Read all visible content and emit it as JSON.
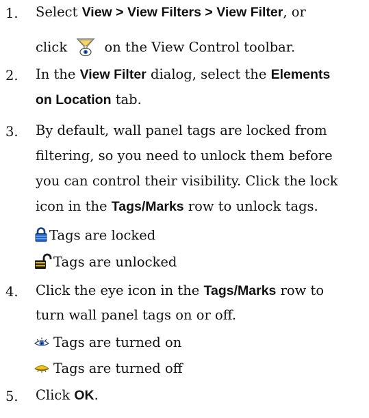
{
  "steps": [
    {
      "number": "1.",
      "line1_a": "Select ",
      "line1_b": "View > View Filters > View Filter",
      "line1_c": ", or",
      "line2_a": "click",
      "line2_icon": "view-filter-funnel-icon",
      "line2_b": "on the View Control toolbar."
    },
    {
      "number": "2.",
      "line1_a": "In the ",
      "line1_b": "View Filter",
      "line1_c": " dialog, select the ",
      "line1_d": "Elements",
      "line2_a": "on Location",
      "line2_b": " tab."
    },
    {
      "number": "3.",
      "line1": "By default, wall panel tags are locked from",
      "line2": "filtering, so you need to unlock them before",
      "line3": "you can control their visibility. Click the lock",
      "line4_a": "icon in the ",
      "line4_b": "Tags/Marks",
      "line4_c": " row to unlock tags.",
      "sub1_icon": "locked-lock-icon",
      "sub1": "Tags are locked",
      "sub2_icon": "unlocked-lock-icon",
      "sub2": "Tags are unlocked"
    },
    {
      "number": "4.",
      "line1_a": "Click the eye icon in the ",
      "line1_b": "Tags/Marks",
      "line1_c": " row to",
      "line2": "turn wall panel tags on or off.",
      "sub1_icon": "eye-open-icon",
      "sub1": "Tags are turned on",
      "sub2_icon": "eye-closed-icon",
      "sub2": "Tags are turned off"
    },
    {
      "number": "5.",
      "line1_a": "Click ",
      "line1_b": "OK",
      "line1_c": "."
    }
  ],
  "colors": {
    "text": "#111111",
    "lock_blue": "#1f5fbf",
    "unlock_gold": "#e2b112",
    "eye_blue": "#3b6fc4",
    "eye_gold": "#f0c418"
  }
}
